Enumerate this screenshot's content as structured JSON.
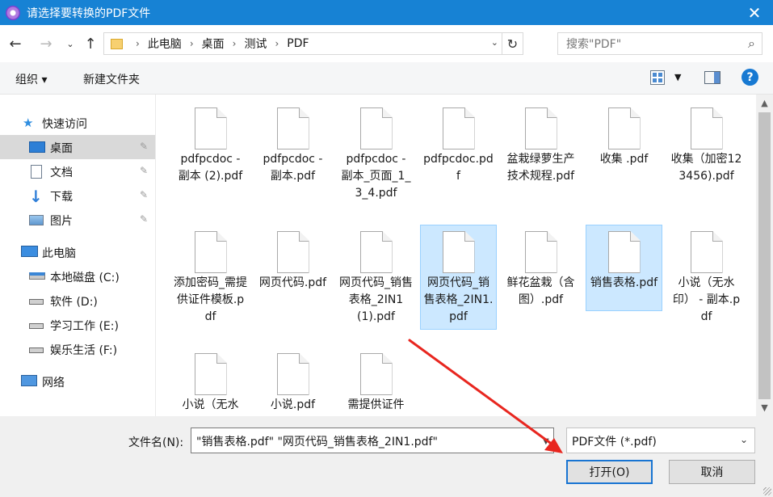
{
  "window": {
    "title": "请选择要转换的PDF文件",
    "close_label": "✕"
  },
  "address_bar": {
    "breadcrumb": [
      "此电脑",
      "桌面",
      "测试",
      "PDF"
    ],
    "search_placeholder": "搜索\"PDF\""
  },
  "toolbar": {
    "organize_label": "组织 ▾",
    "new_folder_label": "新建文件夹",
    "help_label": "?"
  },
  "sidebar": {
    "items": [
      {
        "label": "快速访问",
        "icon": "star-icon"
      },
      {
        "label": "桌面",
        "icon": "desktop-icon",
        "pinned": true,
        "selected": true
      },
      {
        "label": "文档",
        "icon": "document-icon",
        "pinned": true
      },
      {
        "label": "下载",
        "icon": "download-arrow-icon",
        "pinned": true
      },
      {
        "label": "图片",
        "icon": "picture-icon",
        "pinned": true
      },
      {
        "label": "此电脑",
        "icon": "computer-icon"
      },
      {
        "label": "本地磁盘 (C:)",
        "icon": "windows-drive-icon"
      },
      {
        "label": "软件 (D:)",
        "icon": "drive-icon"
      },
      {
        "label": "学习工作 (E:)",
        "icon": "drive-icon"
      },
      {
        "label": "娱乐生活 (F:)",
        "icon": "drive-icon"
      },
      {
        "label": "网络",
        "icon": "network-icon"
      }
    ]
  },
  "files": [
    {
      "name": "pdfpcdoc - 副本 (2).pdf",
      "selected": false
    },
    {
      "name": "pdfpcdoc - 副本.pdf",
      "selected": false
    },
    {
      "name": "pdfpcdoc - 副本_页面_1_3_4.pdf",
      "selected": false
    },
    {
      "name": "pdfpcdoc.pdf",
      "selected": false
    },
    {
      "name": "盆栽绿萝生产技术规程.pdf",
      "selected": false
    },
    {
      "name": "收集 .pdf",
      "selected": false
    },
    {
      "name": "收集（加密123456).pdf",
      "selected": false
    },
    {
      "name": "添加密码_需提供证件模板.pdf",
      "selected": false
    },
    {
      "name": "网页代码.pdf",
      "selected": false
    },
    {
      "name": "网页代码_销售表格_2IN1(1).pdf",
      "selected": false
    },
    {
      "name": "网页代码_销售表格_2IN1.pdf",
      "selected": true
    },
    {
      "name": "鲜花盆栽（含图）.pdf",
      "selected": false
    },
    {
      "name": "销售表格.pdf",
      "selected": true
    },
    {
      "name": "小说（无水印） - 副本.pdf",
      "selected": false
    },
    {
      "name": "小说（无水",
      "selected": false
    },
    {
      "name": "小说.pdf",
      "selected": false
    },
    {
      "name": "需提供证件",
      "selected": false
    }
  ],
  "bottom": {
    "filename_label": "文件名(N):",
    "filename_value": "\"销售表格.pdf\" \"网页代码_销售表格_2IN1.pdf\"",
    "filetype_value": "PDF文件 (*.pdf)",
    "open_label": "打开(O)",
    "cancel_label": "取消"
  },
  "colors": {
    "titlebar": "#1782d4",
    "selection": "#cce8ff",
    "annotation_arrow": "#e8261f"
  }
}
